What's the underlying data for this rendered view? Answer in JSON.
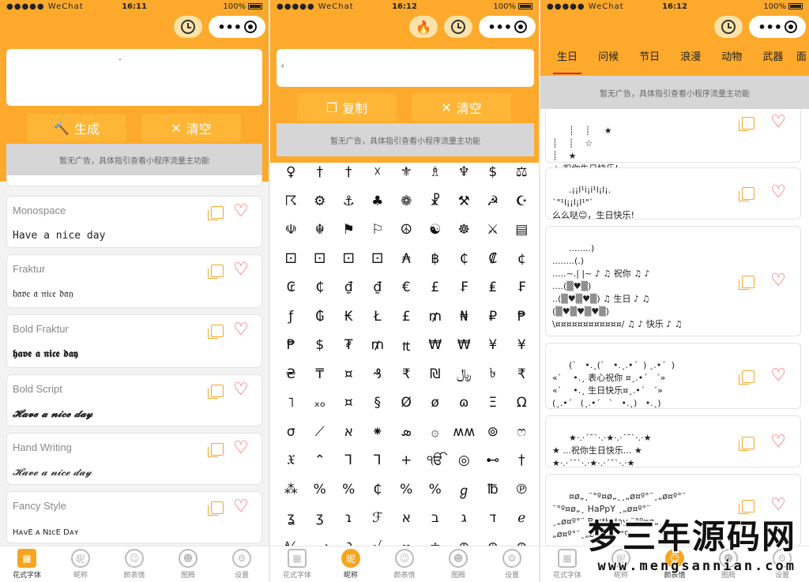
{
  "status": {
    "signal": "●●●●● WeChat",
    "battery": "100%"
  },
  "panel1": {
    "time": "16:11",
    "buttons": {
      "generate": "生成",
      "clear": "清空"
    },
    "ad": "暂无广告，具体指引查看小程序流量主功能",
    "cards": [
      {
        "title": "Monospace",
        "sample": "Have a nice day"
      },
      {
        "title": "Fraktur",
        "sample": "𝔥𝔞𝔳𝔢 𝔞 𝔫𝔦𝔠𝔢 𝔡𝔞𝔶"
      },
      {
        "title": "Bold Fraktur",
        "sample": "𝖍𝖆𝖛𝖊 𝖆 𝖓𝖎𝖈𝖊 𝖉𝖆𝖞"
      },
      {
        "title": "Bold Script",
        "sample": "𝓗𝓪𝓿𝓮 𝓪 𝓷𝓲𝓬𝓮 𝓭𝓪𝔂"
      },
      {
        "title": "Hand Writing",
        "sample": "𝓗𝓪𝓿𝓮 𝓪 𝓷𝓲𝓬𝓮 𝓭𝓪𝔂"
      },
      {
        "title": "Fancy Style",
        "sample": "HᴀᴠE ᴀ NɪᴄE Dᴀʏ"
      }
    ]
  },
  "panel2": {
    "time": "16:12",
    "buttons": {
      "copy": "复制",
      "clear": "清空"
    },
    "ad": "暂无广告，具体指引查看小程序流量主功能",
    "symbols": [
      "♀",
      "†",
      "†",
      "☓",
      "⚜",
      "♗",
      "♆",
      "$",
      "⚖",
      "☈",
      "⚙",
      "⚓",
      "♣",
      "❁",
      "☧",
      "⚒",
      "☭",
      "☪",
      "☫",
      "☬",
      "⚑",
      "⚐",
      "☮",
      "☯",
      "☸",
      "⚔",
      "▤",
      "⚀",
      "⚀",
      "⚀",
      "⚀",
      "₳",
      "฿",
      "₵",
      "₡",
      "¢",
      "₢",
      "₵",
      "₫",
      "₫",
      "€",
      "£",
      "₣",
      "₤",
      "₣",
      "ƒ",
      "₲",
      "₭",
      "Ł",
      "£",
      "₥",
      "₦",
      "₽",
      "₱",
      "₱",
      "$",
      "₮",
      "₥",
      "₶",
      "₩",
      "₩",
      "¥",
      "¥",
      "₴",
      "₸",
      "¤",
      "₰",
      "₹",
      "₪",
      "﷼",
      "৳",
      "₹",
      "˥",
      "ₓₒ",
      "¤",
      "§",
      "Ø",
      "ø",
      "ɷ",
      "Ξ",
      "Ω",
      "σ",
      "⟋",
      "א",
      "⁕",
      "ܣ",
      "۞",
      "ʍʍ",
      "⊚",
      "ෆ",
      "𝔛",
      "⌃",
      "Ꞁ",
      "Ꞁ",
      "+",
      "ੴ",
      "◎",
      "⊷",
      "†",
      "⁂",
      "%",
      "%",
      "₵",
      "%",
      "%",
      "ℊ",
      "℔",
      "℗",
      "ʓ",
      "ʒ",
      "ɿ",
      "ℱ",
      "א",
      "ב",
      "ג",
      "ד",
      "ℯ",
      "⅍",
      "⟿",
      "∂",
      "√",
      "∞",
      "≐",
      "⊕",
      "⊛",
      "⊛"
    ],
    "tabs": [
      "花式字体",
      "昵称",
      "颜表情",
      "图腾",
      "设置"
    ]
  },
  "panel3": {
    "time": "16:12",
    "categories": [
      "生日",
      "问候",
      "节日",
      "浪漫",
      "动物",
      "武器",
      "面"
    ],
    "ad": "暂无广告，具体指引查看小程序流量主功能",
    "cards": [
      "┊    ┊     ★\n┊    ┊    ☆\n┊    ★\n☆ 祝你生日快乐!",
      ".¡¡l¹i¡i¹l¡l¡.\n`\"¹l¡¡l¡l¹\"`\n么么哒😊，生日快乐!",
      "........)\n........(.)\n.....~.| |~ ♪ ♫ 祝你 ♫ ♪\n....(▒♥▒)\n..(▒♥▒♥▒) ♫ 生日 ♪ ♫\n(▒♥▒♥▒♥▒)\n\\¤¤¤¤¤¤¤¤¤¤¤¤/ ♫ ♪ 快乐 ♪ ♫",
      "(`   •.¸(`   •.¸.•´  ) ¸.•´  )\n«`    •.¸ 表心祝你 ¤¸.•´   ´»\n«`    •.¸ 生日快乐¤¸.•´   ´»\n(¸.•´   (¸.•´   `   •.¸)   •.¸)",
      "★·.·´¯`·.·★·.·´¯`·.·★\n★ ...祝你生日快乐... ★\n★·.·´¯`·.·★·.·´¯`·.·★",
      "¤ø„¸¨°º¤ø„¸¸„ø¤º°¨¸„ø¤º°¨\n¨°º¤ø„¸ HaPpY ¸„ø¤º°¨\n¸„ø¤º°¨ BiRtHday ¨°º¤ø„¸\n„ø¤º°¨¸„ø¤º°¨ ¨°º¤ø„¸"
    ]
  },
  "tabs": [
    "花式字体",
    "昵称",
    "颜表情",
    "图腾",
    "设置"
  ],
  "watermark": {
    "cn": "梦三年源码网",
    "url": "www.mengsannian.com"
  }
}
